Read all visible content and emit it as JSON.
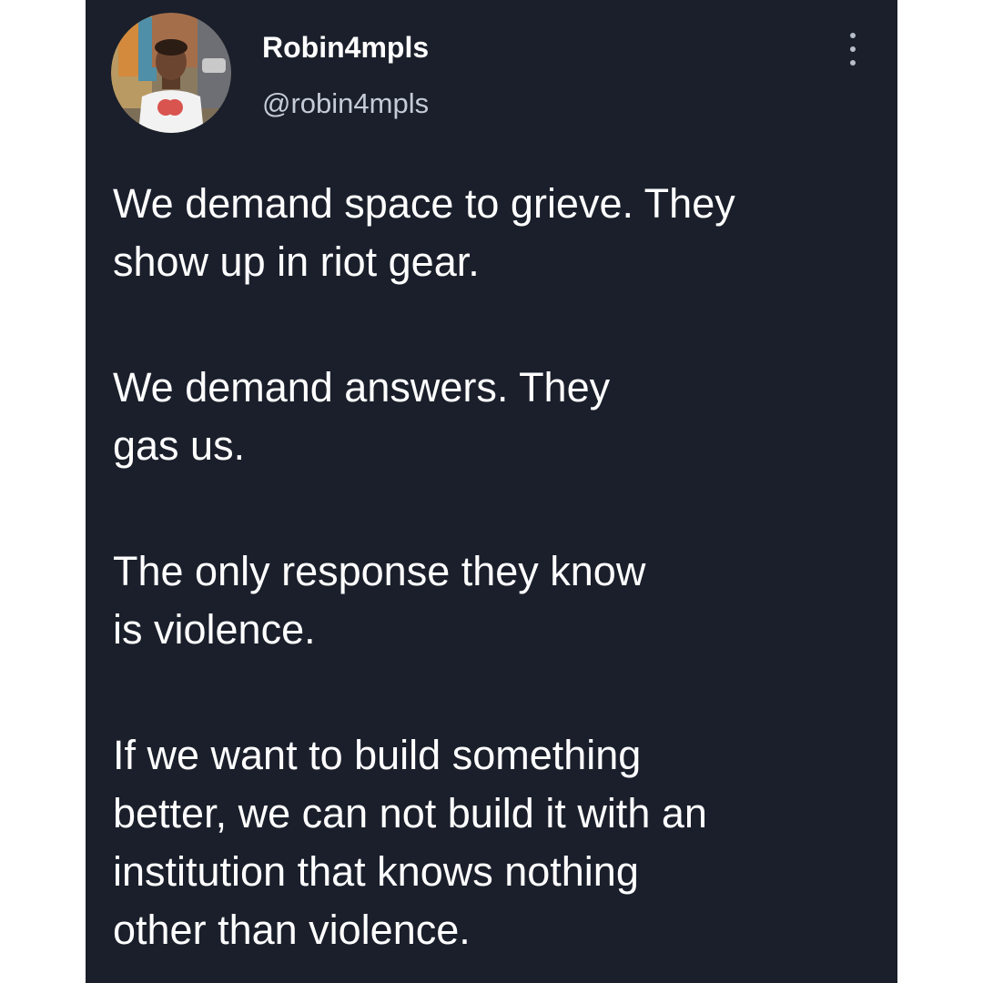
{
  "colors": {
    "background": "#ffffff",
    "card": "#1a1f2b",
    "text_primary": "#ffffff",
    "text_secondary": "#c5ccd6",
    "icon": "#b8bec8"
  },
  "author": {
    "display_name": "Robin4mpls",
    "handle": "@robin4mpls",
    "avatar_icon": "profile-photo"
  },
  "actions": {
    "more_icon": "more-vertical-icon"
  },
  "tweet": {
    "paragraphs": [
      "We demand space to grieve. They\nshow up in riot gear.",
      "We demand answers. They\ngas us.",
      "The only response they know\nis violence.",
      "If we want to build something\nbetter, we can not build it with an\ninstitution that knows nothing\nother than violence."
    ]
  }
}
